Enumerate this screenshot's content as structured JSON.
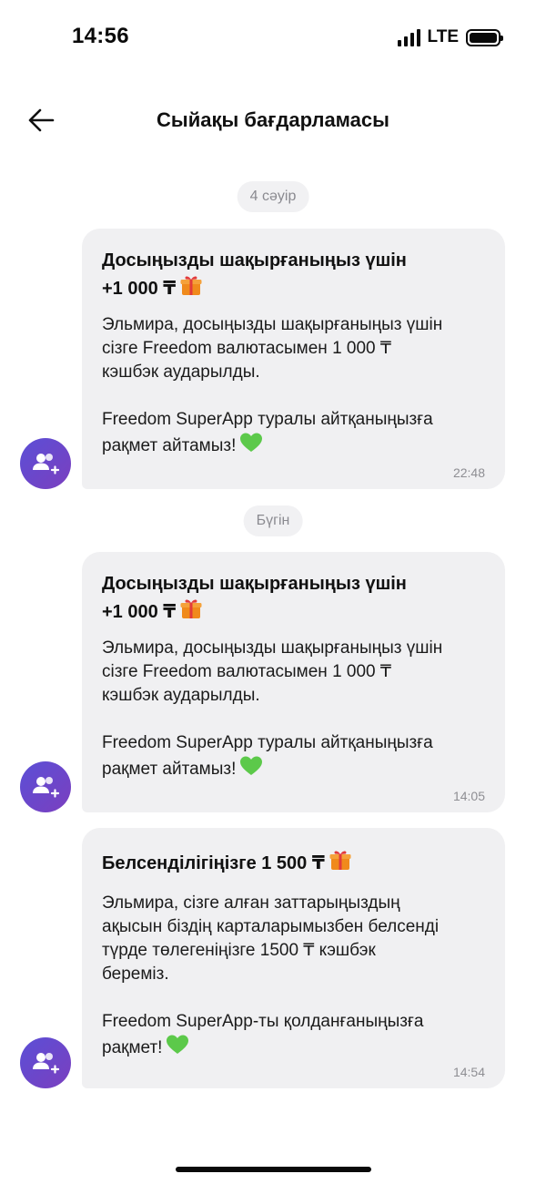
{
  "status_bar": {
    "time": "14:56",
    "network": "LTE"
  },
  "header": {
    "title": "Сыйақы бағдарламасы"
  },
  "date_chips": [
    "4 сәуір",
    "Бүгін"
  ],
  "messages": [
    {
      "title_line1": "Досыңызды шақырғаныңыз үшін",
      "title_line2": "+1 000 ₸",
      "body": "Эльмира, досыңызды шақырғаныңыз үшін\nсізге Freedom валютасымен 1 000 ₸\nкэшбэк аударылды.\n\nFreedom SuperApp туралы айтқаныңызға\nрақмет айтамыз!",
      "time": "22:48"
    },
    {
      "title_line1": "Досыңызды шақырғаныңыз үшін",
      "title_line2": "+1 000 ₸",
      "body": "Эльмира, досыңызды шақырғаныңыз үшін\nсізге Freedom валютасымен 1 000 ₸\nкэшбэк аударылды.\n\nFreedom SuperApp туралы айтқаныңызға\nрақмет айтамыз!",
      "time": "14:05"
    },
    {
      "title_line1": "Белсенділігіңізге 1 500 ₸",
      "title_line2": "",
      "body": "Эльмира, сізге алған заттарыңыздың\nақысын біздің карталарымызбен белсенді\nтүрде төлегеніңізге 1500 ₸ кэшбэк\nбереміз.\n\nFreedom SuperApp-ты қолданғаныңызға\nрақмет!",
      "time": "14:54"
    }
  ],
  "icons": {
    "avatar": "users-add-icon",
    "gift": "gift-icon",
    "heart": "green-heart-icon"
  },
  "colors": {
    "accent_avatar_start": "#5b4fd6",
    "accent_avatar_end": "#7b3fbf",
    "bubble_bg": "#f0f0f2",
    "heart_green": "#5cc94a",
    "gift_orange": "#f08a1c",
    "gift_red": "#e23b3b"
  }
}
